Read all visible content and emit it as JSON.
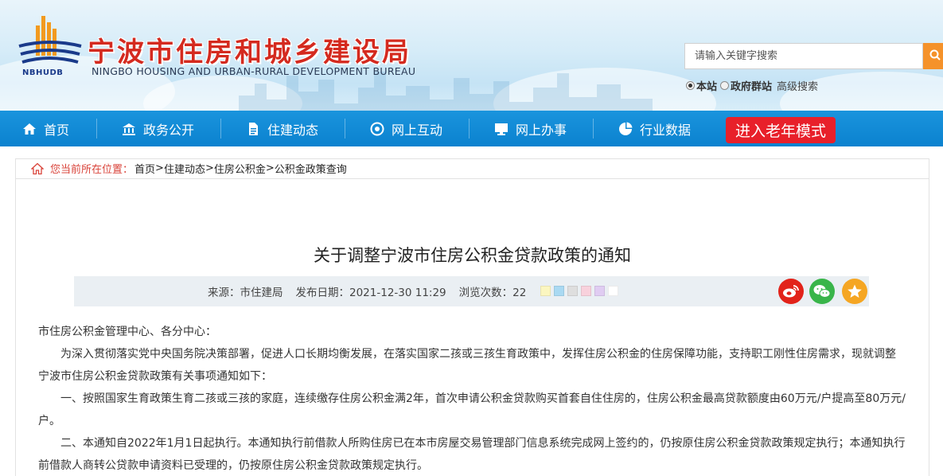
{
  "header": {
    "logo_abbr": "NBHUDB",
    "title": "宁波市住房和城乡建设局",
    "subtitle": "NINGBO HOUSING AND URBAN-RURAL DEVELOPMENT BUREAU",
    "search": {
      "placeholder": "请输入关键字搜索",
      "scope_options": [
        {
          "label": "本站",
          "selected": true
        },
        {
          "label": "政府群站",
          "selected": false
        }
      ],
      "advanced_label": "高级搜索"
    }
  },
  "nav": {
    "items": [
      {
        "label": "首页",
        "icon": "home-icon"
      },
      {
        "label": "政务公开",
        "icon": "government-icon"
      },
      {
        "label": "住建动态",
        "icon": "document-icon"
      },
      {
        "label": "网上互动",
        "icon": "chat-icon"
      },
      {
        "label": "网上办事",
        "icon": "monitor-icon"
      },
      {
        "label": "行业数据",
        "icon": "pie-chart-icon"
      }
    ],
    "elder_mode_label": "进入老年模式"
  },
  "breadcrumb": {
    "location_label": "您当前所在位置：",
    "items": [
      "首页",
      "住建动态",
      "住房公积金",
      "公积金政策查询"
    ],
    "separator": ">"
  },
  "article": {
    "title": "关于调整宁波市住房公积金贷款政策的通知",
    "meta": {
      "source": "来源：市住建局",
      "date": "发布日期：2021-12-30 11:29",
      "views": "浏览次数：22"
    },
    "swatch_colors": [
      "#fbf6c0",
      "#a9d9f2",
      "#dedede",
      "#f8d1dc",
      "#e0ccf2",
      "#ffffff"
    ],
    "share_icons": [
      {
        "name": "weibo-icon",
        "color": "#e2231a"
      },
      {
        "name": "wechat-icon",
        "color": "#39b54a"
      },
      {
        "name": "favorite-star-icon",
        "color": "#f5a623"
      }
    ],
    "paragraphs": [
      {
        "text": "市住房公积金管理中心、各分中心：",
        "indent": false
      },
      {
        "text": "为深入贯彻落实党中央国务院决策部署，促进人口长期均衡发展，在落实国家二孩或三孩生育政策中，发挥住房公积金的住房保障功能，支持职工刚性住房需求，现就调整宁波市住房公积金贷款政策有关事项通知如下：",
        "indent": true
      },
      {
        "text": "一、按照国家生育政策生育二孩或三孩的家庭，连续缴存住房公积金满2年，首次申请公积金贷款购买首套自住住房的，住房公积金最高贷款额度由60万元/户提高至80万元/户。",
        "indent": true
      },
      {
        "text": "二、本通知自2022年1月1日起执行。本通知执行前借款人所购住房已在本市房屋交易管理部门信息系统完成网上签约的，仍按原住房公积金贷款政策规定执行；本通知执行前借款人商转公贷款申请资料已受理的，仍按原住房公积金贷款政策规定执行。",
        "indent": true
      }
    ]
  }
}
